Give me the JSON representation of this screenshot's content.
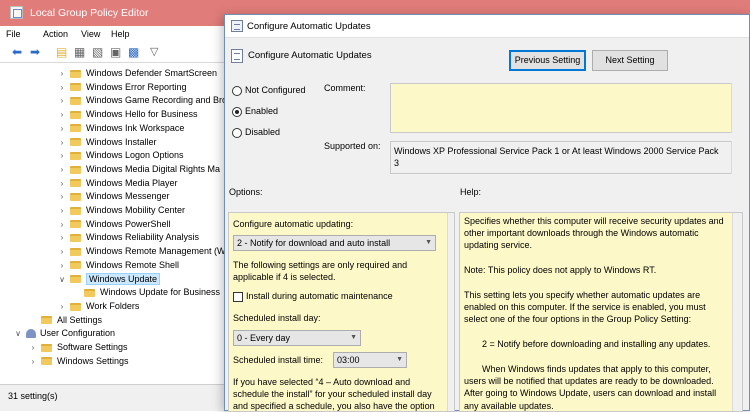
{
  "editor": {
    "title": "Local Group Policy Editor",
    "menu": [
      "File",
      "Action",
      "View",
      "Help"
    ],
    "tree": [
      {
        "label": "Windows Defender SmartScreen",
        "indent": 1
      },
      {
        "label": "Windows Error Reporting",
        "indent": 1
      },
      {
        "label": "Windows Game Recording and Bro",
        "indent": 1
      },
      {
        "label": "Windows Hello for Business",
        "indent": 1
      },
      {
        "label": "Windows Ink Workspace",
        "indent": 1
      },
      {
        "label": "Windows Installer",
        "indent": 1
      },
      {
        "label": "Windows Logon Options",
        "indent": 1
      },
      {
        "label": "Windows Media Digital Rights Ma",
        "indent": 1
      },
      {
        "label": "Windows Media Player",
        "indent": 1
      },
      {
        "label": "Windows Messenger",
        "indent": 1
      },
      {
        "label": "Windows Mobility Center",
        "indent": 1
      },
      {
        "label": "Windows PowerShell",
        "indent": 1
      },
      {
        "label": "Windows Reliability Analysis",
        "indent": 1
      },
      {
        "label": "Windows Remote Management (W",
        "indent": 1
      },
      {
        "label": "Windows Remote Shell",
        "indent": 1
      },
      {
        "label": "Windows Update",
        "indent": 1
      },
      {
        "label": "Windows Update for Business",
        "indent": 2
      },
      {
        "label": "Work Folders",
        "indent": 1
      },
      {
        "label": "All Settings",
        "indent": 0
      },
      {
        "label": "User Configuration",
        "indent": -1
      },
      {
        "label": "Software Settings",
        "indent": 0
      },
      {
        "label": "Windows Settings",
        "indent": 0
      }
    ],
    "status": "31 setting(s)"
  },
  "dialog": {
    "title": "Configure Automatic Updates",
    "header": "Configure Automatic Updates",
    "prev_button": "Previous Setting",
    "next_button": "Next Setting",
    "radio_not_configured": "Not Configured",
    "radio_enabled": "Enabled",
    "radio_disabled": "Disabled",
    "selected_state": "Enabled",
    "comment_label": "Comment:",
    "comment_value": "",
    "supported_label": "Supported on:",
    "supported_value": "Windows XP Professional Service Pack 1 or At least Windows 2000 Service Pack 3",
    "options_label": "Options:",
    "help_label": "Help:",
    "options": {
      "configure_label": "Configure automatic updating:",
      "configure_value": "2 - Notify for download and auto install",
      "note": "The following settings are only required and applicable if 4 is selected.",
      "install_maintenance_label": "Install during automatic maintenance",
      "install_maintenance_checked": false,
      "scheduled_day_label": "Scheduled install day:",
      "scheduled_day_value": "0 - Every day",
      "scheduled_time_label": "Scheduled install time:",
      "scheduled_time_value": "03:00",
      "footer_text": "If you have selected “4 – Auto download and schedule the install” for your scheduled install day and specified a schedule, you also have the option"
    },
    "help": [
      "Specifies whether this computer will receive security updates and other important downloads through the Windows automatic updating service.",
      "Note: This policy does not apply to Windows RT.",
      "This setting lets you specify whether automatic updates are enabled on this computer. If the service is enabled, you must select one of the four options in the Group Policy Setting:",
      "2 = Notify before downloading and installing any updates.",
      "When Windows finds updates that apply to this computer, users will be notified that updates are ready to be downloaded. After going to Windows Update, users can download and install any available updates."
    ]
  }
}
